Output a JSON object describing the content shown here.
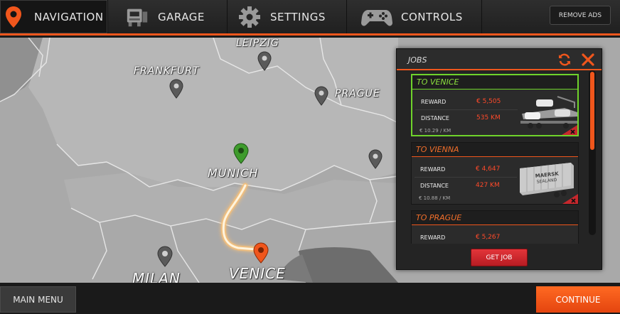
{
  "nav": {
    "tabs": [
      {
        "label": "NAVIGATION",
        "icon": "map-pin-icon",
        "active": true
      },
      {
        "label": "GARAGE",
        "icon": "truck-icon",
        "active": false
      },
      {
        "label": "SETTINGS",
        "icon": "gear-icon",
        "active": false
      },
      {
        "label": "CONTROLS",
        "icon": "gamepad-icon",
        "active": false
      }
    ],
    "remove_ads_label": "REMOVE ADS"
  },
  "map": {
    "cities": [
      {
        "name": "LEIPZIG",
        "pin": "gray"
      },
      {
        "name": "FRANKFURT",
        "pin": "gray"
      },
      {
        "name": "PRAGUE",
        "pin": "gray"
      },
      {
        "name": "MUNICH",
        "pin": "green"
      },
      {
        "name": "VENICE",
        "pin": "orange"
      },
      {
        "name": "MILAN",
        "pin": "gray"
      }
    ]
  },
  "jobs": {
    "title": "JOBS",
    "list": [
      {
        "destination": "TO VENICE",
        "reward_label": "REWARD",
        "reward": "€ 5,505",
        "distance_label": "DISTANCE",
        "distance": "535 KM",
        "rate": "€ 10.29 / KM",
        "cargo": "car-carrier-trailer",
        "selected": true
      },
      {
        "destination": "TO VIENNA",
        "reward_label": "REWARD",
        "reward": "€ 4,647",
        "distance_label": "DISTANCE",
        "distance": "427 KM",
        "rate": "€ 10.88 / KM",
        "cargo": "container-trailer",
        "container_text": "MAERSK SEALAND",
        "selected": false
      },
      {
        "destination": "TO PRAGUE",
        "reward_label": "REWARD",
        "reward": "€ 5,267",
        "cargo": "wood-trailer",
        "selected": false
      }
    ],
    "get_job_label": "GET JOB"
  },
  "bottom": {
    "main_menu_label": "MAIN MENU",
    "continue_label": "CONTINUE"
  },
  "colors": {
    "accent": "#f0561c",
    "selected_green": "#6fd32b",
    "value_red": "#ff4a2a",
    "button_red": "#d12a2f"
  }
}
